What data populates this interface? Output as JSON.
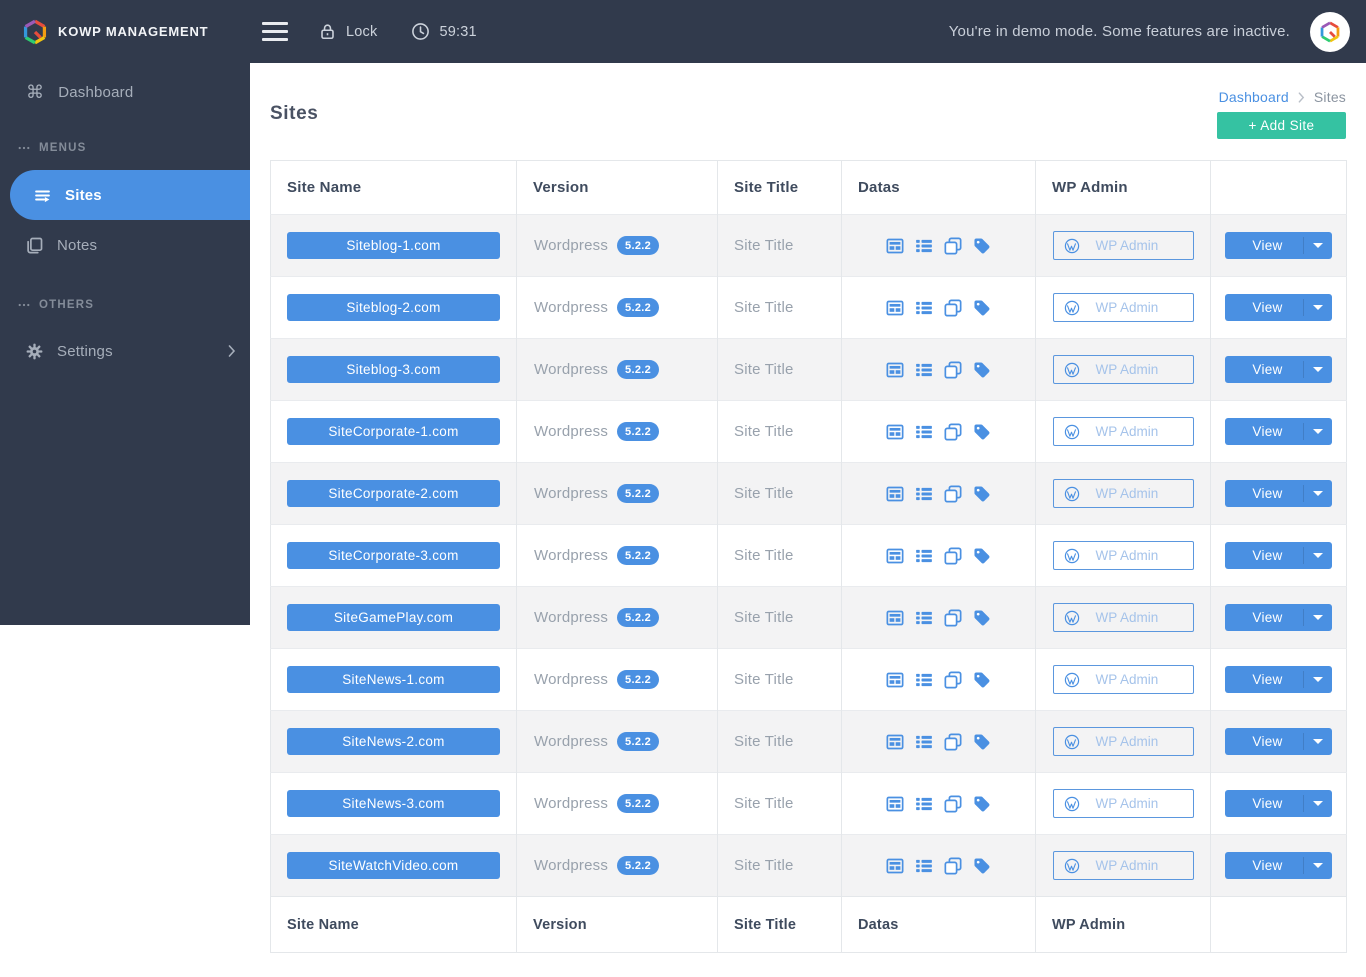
{
  "brand": {
    "name": "KOWP MANAGEMENT"
  },
  "topbar": {
    "lock_label": "Lock",
    "timer": "59:31",
    "demo_notice": "You're in demo mode. Some features are inactive."
  },
  "sidebar": {
    "dashboard_label": "Dashboard",
    "sections": [
      {
        "heading": "MENUS",
        "items": [
          {
            "label": "Sites",
            "active": true
          },
          {
            "label": "Notes",
            "active": false
          }
        ]
      },
      {
        "heading": "OTHERS",
        "items": [
          {
            "label": "Settings",
            "active": false
          }
        ]
      }
    ]
  },
  "page": {
    "title": "Sites",
    "breadcrumb": {
      "parent": "Dashboard",
      "current": "Sites"
    },
    "add_button_label": "+  Add Site"
  },
  "table": {
    "headers": {
      "site_name": "Site Name",
      "version": "Version",
      "site_title": "Site Title",
      "datas": "Datas",
      "wp_admin": "WP Admin",
      "actions": ""
    },
    "datas_icons": [
      "table-icon",
      "th-list-icon",
      "clone-icon",
      "tag-icon"
    ],
    "rows": [
      {
        "site": "Siteblog-1.com",
        "platform": "Wordpress",
        "version": "5.2.2",
        "title": "Site Title",
        "wp_admin": "WP Admin",
        "view": "View"
      },
      {
        "site": "Siteblog-2.com",
        "platform": "Wordpress",
        "version": "5.2.2",
        "title": "Site Title",
        "wp_admin": "WP Admin",
        "view": "View"
      },
      {
        "site": "Siteblog-3.com",
        "platform": "Wordpress",
        "version": "5.2.2",
        "title": "Site Title",
        "wp_admin": "WP Admin",
        "view": "View"
      },
      {
        "site": "SiteCorporate-1.com",
        "platform": "Wordpress",
        "version": "5.2.2",
        "title": "Site Title",
        "wp_admin": "WP Admin",
        "view": "View"
      },
      {
        "site": "SiteCorporate-2.com",
        "platform": "Wordpress",
        "version": "5.2.2",
        "title": "Site Title",
        "wp_admin": "WP Admin",
        "view": "View"
      },
      {
        "site": "SiteCorporate-3.com",
        "platform": "Wordpress",
        "version": "5.2.2",
        "title": "Site Title",
        "wp_admin": "WP Admin",
        "view": "View"
      },
      {
        "site": "SiteGamePlay.com",
        "platform": "Wordpress",
        "version": "5.2.2",
        "title": "Site Title",
        "wp_admin": "WP Admin",
        "view": "View"
      },
      {
        "site": "SiteNews-1.com",
        "platform": "Wordpress",
        "version": "5.2.2",
        "title": "Site Title",
        "wp_admin": "WP Admin",
        "view": "View"
      },
      {
        "site": "SiteNews-2.com",
        "platform": "Wordpress",
        "version": "5.2.2",
        "title": "Site Title",
        "wp_admin": "WP Admin",
        "view": "View"
      },
      {
        "site": "SiteNews-3.com",
        "platform": "Wordpress",
        "version": "5.2.2",
        "title": "Site Title",
        "wp_admin": "WP Admin",
        "view": "View"
      },
      {
        "site": "SiteWatchVideo.com",
        "platform": "Wordpress",
        "version": "5.2.2",
        "title": "Site Title",
        "wp_admin": "WP Admin",
        "view": "View"
      }
    ]
  },
  "colors": {
    "accent_blue": "#4a90e2",
    "accent_teal": "#35c2a2",
    "dark_navy": "#313a4c",
    "row_stripe": "#f3f3f4"
  }
}
